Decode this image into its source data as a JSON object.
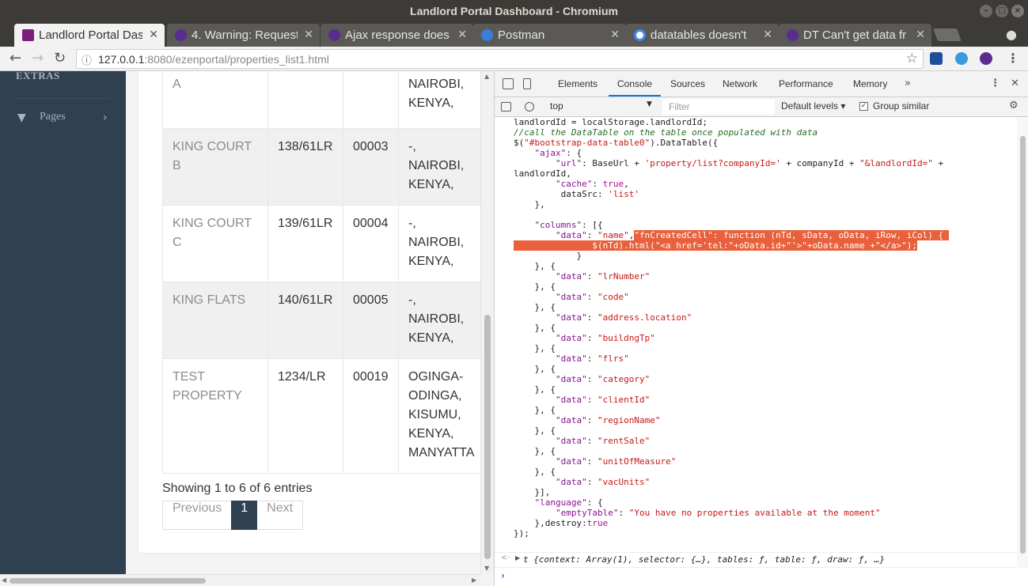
{
  "window": {
    "title": "Landlord Portal Dashboard - Chromium"
  },
  "tabs": [
    {
      "label": "Landlord Portal Das",
      "active": true,
      "favicon_color": "#7a1f7a"
    },
    {
      "label": "4. Warning: Request",
      "active": false,
      "favicon_color": "#5b2c8f"
    },
    {
      "label": "Ajax response does",
      "active": false,
      "favicon_color": "#5b2c8f"
    },
    {
      "label": "Postman",
      "active": false,
      "favicon_color": "#3b7ddd"
    },
    {
      "label": "datatables doesn't",
      "active": false,
      "favicon_color": "#4285f4"
    },
    {
      "label": "DT Can't get data fr",
      "active": false,
      "favicon_color": "#5b2c8f"
    }
  ],
  "toolbar": {
    "url_host": "127.0.0.1",
    "url_rest": ":8080/ezenportal/properties_list1.html"
  },
  "sidebar": {
    "section": "EXTRAS",
    "items": [
      {
        "label": "Pages"
      }
    ]
  },
  "table": {
    "rows": [
      {
        "name": "A",
        "lr": "",
        "code": "",
        "location": "NAIROBI,\nKENYA,"
      },
      {
        "name": "KING COURT\nB",
        "lr": "138/61LR",
        "code": "00003",
        "location": "-,\nNAIROBI,\nKENYA,"
      },
      {
        "name": "KING COURT\nC",
        "lr": "139/61LR",
        "code": "00004",
        "location": "-,\nNAIROBI,\nKENYA,"
      },
      {
        "name": "KING FLATS",
        "lr": "140/61LR",
        "code": "00005",
        "location": "-,\nNAIROBI,\nKENYA,"
      },
      {
        "name": "TEST\nPROPERTY",
        "lr": "1234/LR",
        "code": "00019",
        "location": "OGINGA-\nODINGA,\nKISUMU,\nKENYA,\nMANYATTA"
      }
    ],
    "info": "Showing 1 to 6 of 6 entries",
    "pagination": {
      "previous": "Previous",
      "current": "1",
      "next": "Next"
    }
  },
  "devtools": {
    "tabs": [
      "Elements",
      "Console",
      "Sources",
      "Network",
      "Performance",
      "Memory"
    ],
    "active_tab": "Console",
    "context": "top",
    "filter_placeholder": "Filter",
    "levels": "Default levels",
    "group_similar": "Group similar",
    "result": "t {context: Array(1), selector: {…}, tables: ƒ, table: ƒ, draw: ƒ, …}"
  },
  "colors": {
    "sidebar_bg": "#2f4050",
    "highlight": "#e8603c",
    "devtools_accent": "#1a73e8"
  }
}
